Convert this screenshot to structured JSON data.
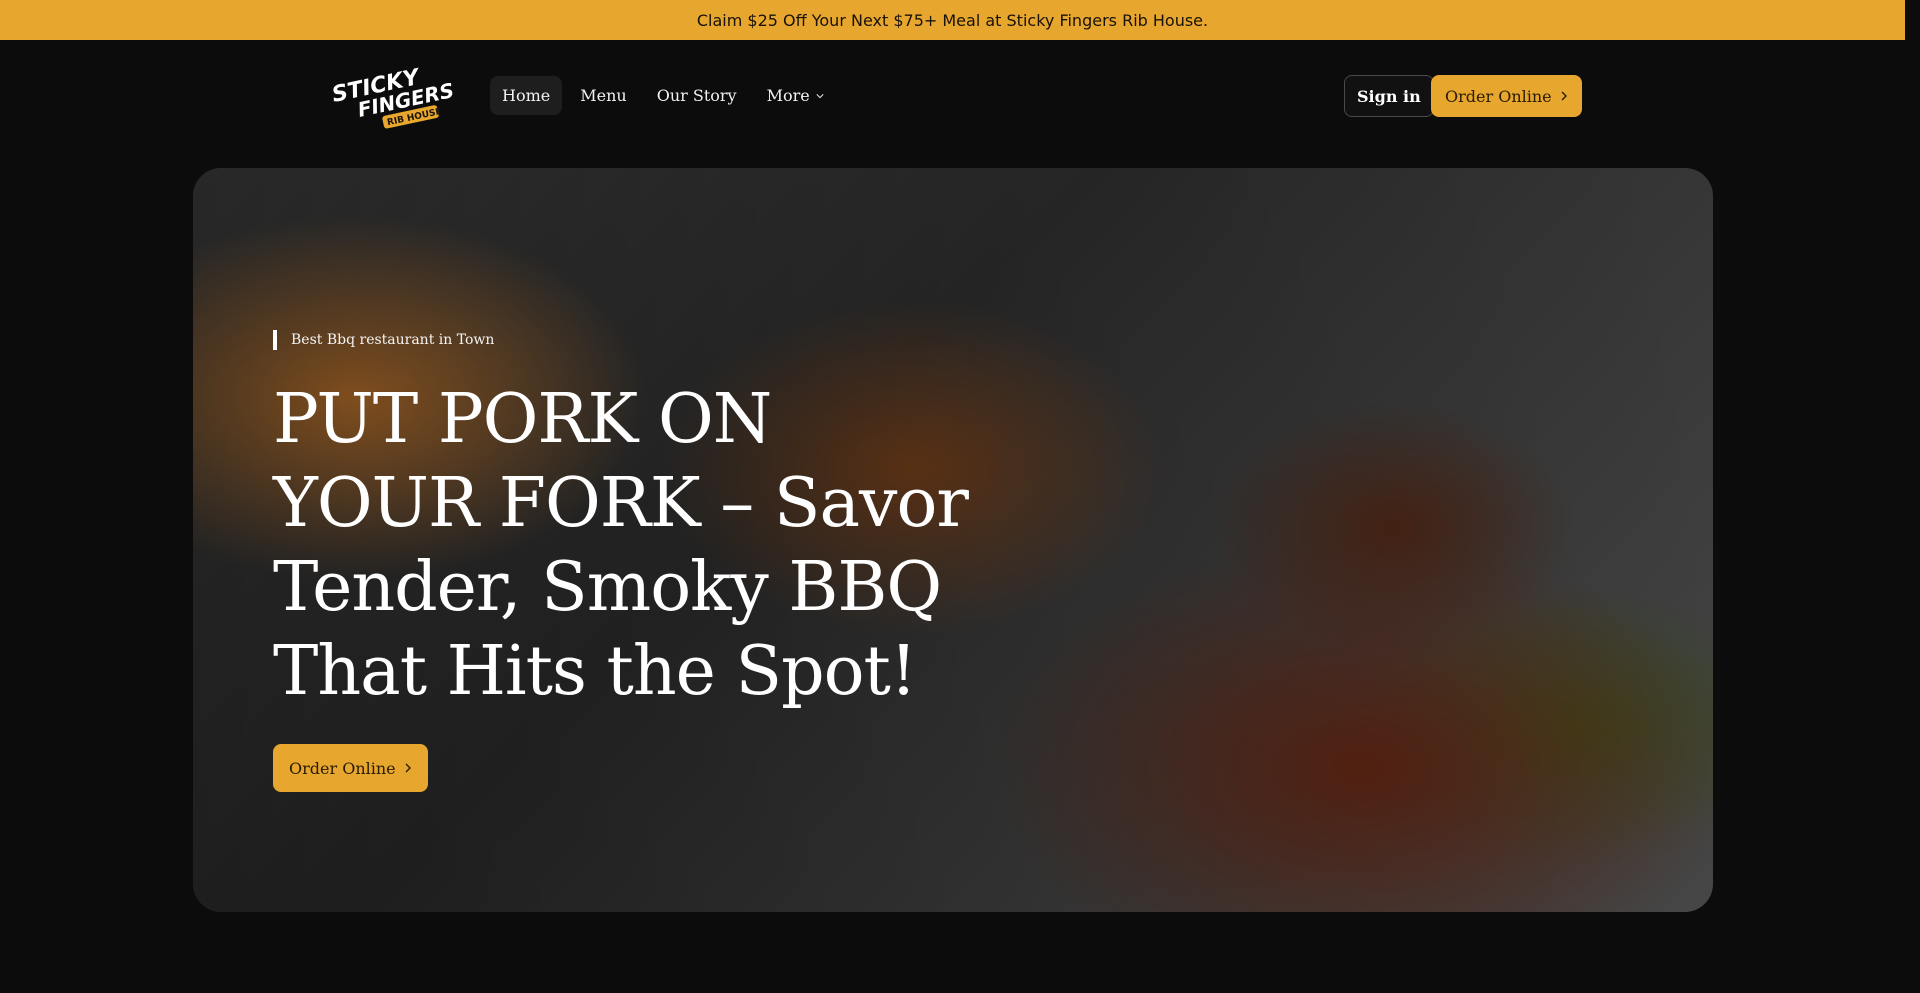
{
  "promo": {
    "text": "Claim $25 Off Your Next $75+ Meal at Sticky Fingers Rib House."
  },
  "brand": {
    "name": "Sticky Fingers Rib House",
    "logo_line1": "STICKY",
    "logo_line2": "FINGERS",
    "logo_line3": "RIB HOUSE"
  },
  "nav": {
    "items": [
      {
        "label": "Home",
        "active": true
      },
      {
        "label": "Menu"
      },
      {
        "label": "Our Story"
      },
      {
        "label": "More"
      }
    ],
    "sign_in": "Sign in",
    "order_online": "Order Online"
  },
  "hero": {
    "tagline": "Best Bbq restaurant in Town",
    "headline_lines": [
      "PUT PORK ON",
      "YOUR FORK – Savor",
      "Tender, Smoky BBQ",
      "That Hits the Spot!"
    ],
    "cta": "Order Online"
  },
  "colors": {
    "accent": "#e7a62d",
    "background": "#0c0c0c"
  }
}
